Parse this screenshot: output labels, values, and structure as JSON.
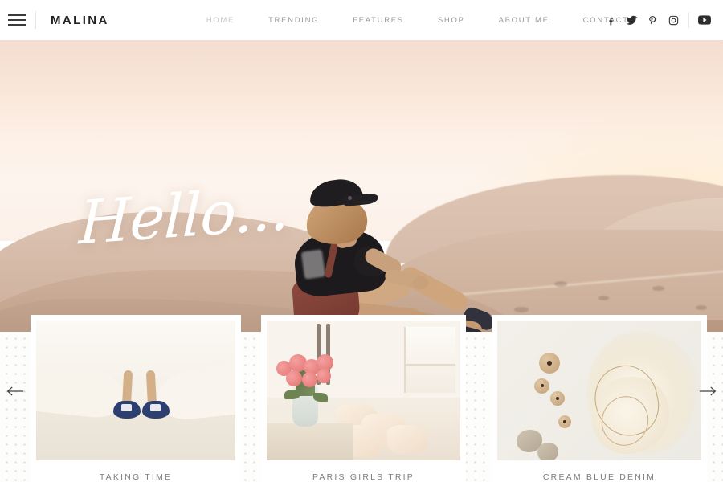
{
  "header": {
    "menu_icon": "hamburger-icon",
    "brand": "MALINA",
    "nav": [
      {
        "label": "HOME",
        "active": true
      },
      {
        "label": "TRENDING",
        "active": false
      },
      {
        "label": "FEATURES",
        "active": false
      },
      {
        "label": "SHOP",
        "active": false
      },
      {
        "label": "ABOUT ME",
        "active": false
      },
      {
        "label": "CONTACT",
        "active": false
      }
    ],
    "social": [
      {
        "name": "facebook-icon",
        "label": "f"
      },
      {
        "name": "twitter-icon",
        "label": "t"
      },
      {
        "name": "pinterest-icon",
        "label": "p"
      },
      {
        "name": "instagram-icon",
        "label": "ig"
      },
      {
        "name": "youtube-icon",
        "label": "yt"
      }
    ]
  },
  "hero": {
    "headline": "Hello...",
    "alt": "Woman in black cap sitting on a desert sand dune at sunset"
  },
  "carousel": {
    "prev_label": "←",
    "next_label": "→",
    "cards": [
      {
        "caption": "TAKING TIME",
        "alt": "Blue shoes peeking from under a white dress on sand"
      },
      {
        "caption": "PARIS GIRLS TRIP",
        "alt": "Pink roses in a glass vase beside a bed with cream pillows"
      },
      {
        "caption": "CREAM BLUE DENIM",
        "alt": "Wooden beads and cream wool fibre tied with twine"
      }
    ]
  },
  "colors": {
    "brand_text": "#222222",
    "nav_text": "#9a9893",
    "nav_active": "#c9c6c1",
    "caption_text": "#807d78",
    "page_background": "#fdfdfc",
    "hero_sky": "#fbeade",
    "hero_sand": "#c2a48f"
  }
}
